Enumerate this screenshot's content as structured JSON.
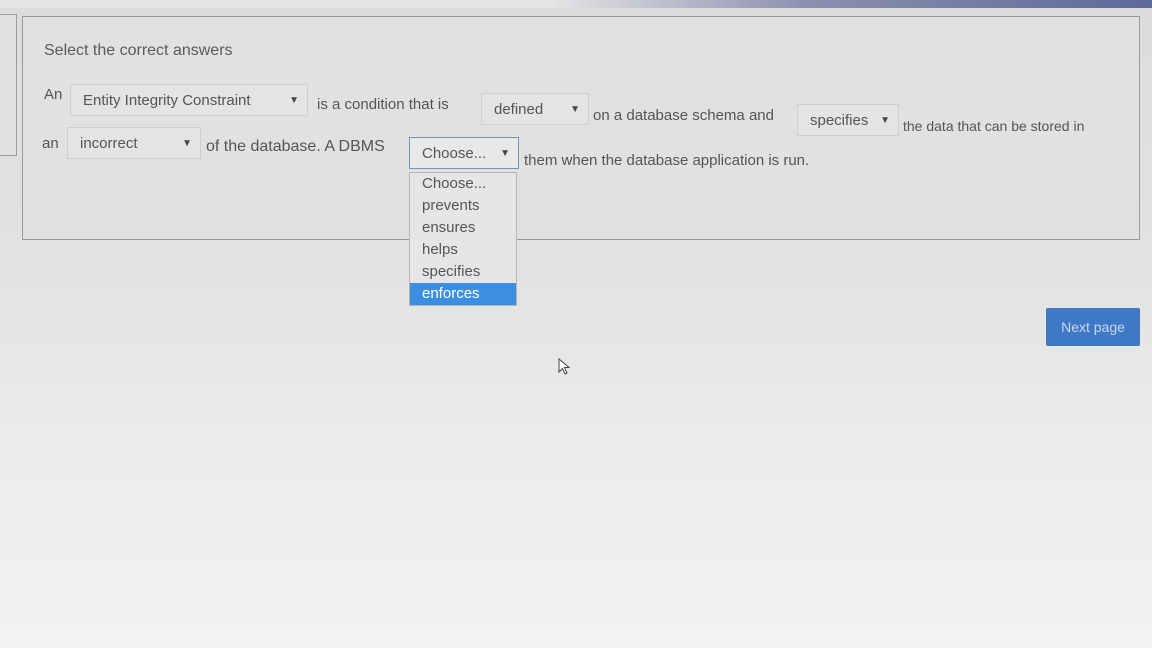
{
  "question": {
    "label": "Select the correct answers",
    "sentence": {
      "t1": "An",
      "t2": "is a condition that is",
      "t3": "on a database schema and",
      "t4": "the data that can be stored in",
      "t5": "an",
      "t6": "of the database. A DBMS",
      "t7": "them when the database application is run."
    },
    "selects": {
      "s1": "Entity Integrity Constraint",
      "s2": "defined",
      "s3": "specifies",
      "s4": "incorrect",
      "s5": "Choose..."
    },
    "dropdown_options": [
      "Choose...",
      "prevents",
      "ensures",
      "helps",
      "specifies",
      "enforces"
    ],
    "highlighted_option": "enforces"
  },
  "navigation": {
    "next_label": "Next page"
  },
  "colors": {
    "accent": "#3f79c5",
    "highlight": "#3c8ee0"
  },
  "icons": {
    "caret": "caret-down-icon",
    "cursor": "mouse-pointer-icon"
  }
}
